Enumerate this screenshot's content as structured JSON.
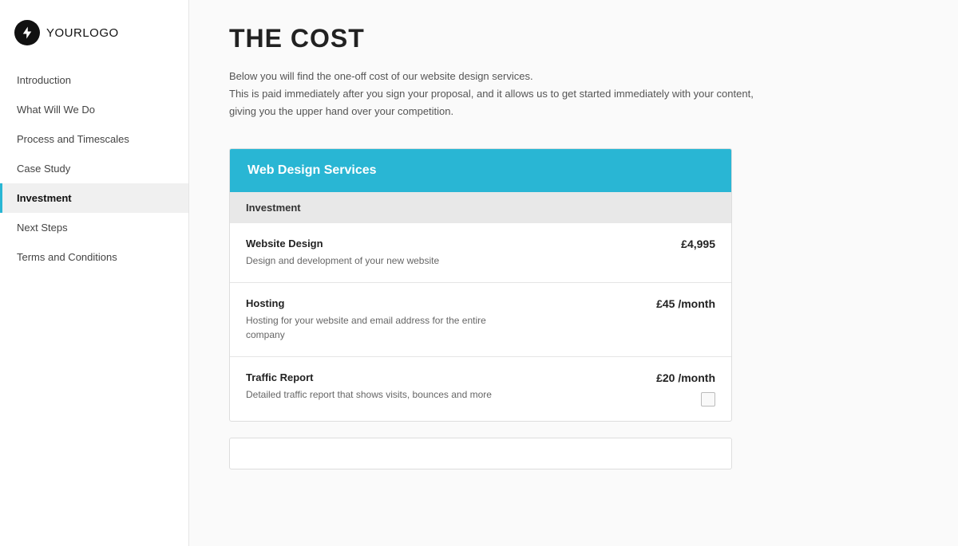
{
  "logo": {
    "text_bold": "YOUR",
    "text_normal": "LOGO"
  },
  "sidebar": {
    "items": [
      {
        "label": "Introduction",
        "id": "introduction",
        "active": false
      },
      {
        "label": "What Will We Do",
        "id": "what-will-we-do",
        "active": false
      },
      {
        "label": "Process and Timescales",
        "id": "process-and-timescales",
        "active": false
      },
      {
        "label": "Case Study",
        "id": "case-study",
        "active": false
      },
      {
        "label": "Investment",
        "id": "investment",
        "active": true
      },
      {
        "label": "Next Steps",
        "id": "next-steps",
        "active": false
      },
      {
        "label": "Terms and Conditions",
        "id": "terms-and-conditions",
        "active": false
      }
    ]
  },
  "main": {
    "title": "THE COST",
    "subtitle_line1": "Below you will find the one-off cost of our website design services.",
    "subtitle_line2": "This is paid immediately after you sign your proposal, and it allows us to get started immediately with your content, giving you the upper hand over your competition.",
    "services_card": {
      "header": "Web Design Services",
      "investment_label": "Investment",
      "items": [
        {
          "name": "Website Design",
          "desc": "Design and development of your new website",
          "price": "£4,995",
          "has_checkbox": false
        },
        {
          "name": "Hosting",
          "desc": "Hosting for your website and email address for the entire company",
          "price": "£45 /month",
          "has_checkbox": false
        },
        {
          "name": "Traffic Report",
          "desc": "Detailed traffic report that shows visits, bounces and more",
          "price": "£20 /month",
          "has_checkbox": true
        }
      ]
    }
  }
}
